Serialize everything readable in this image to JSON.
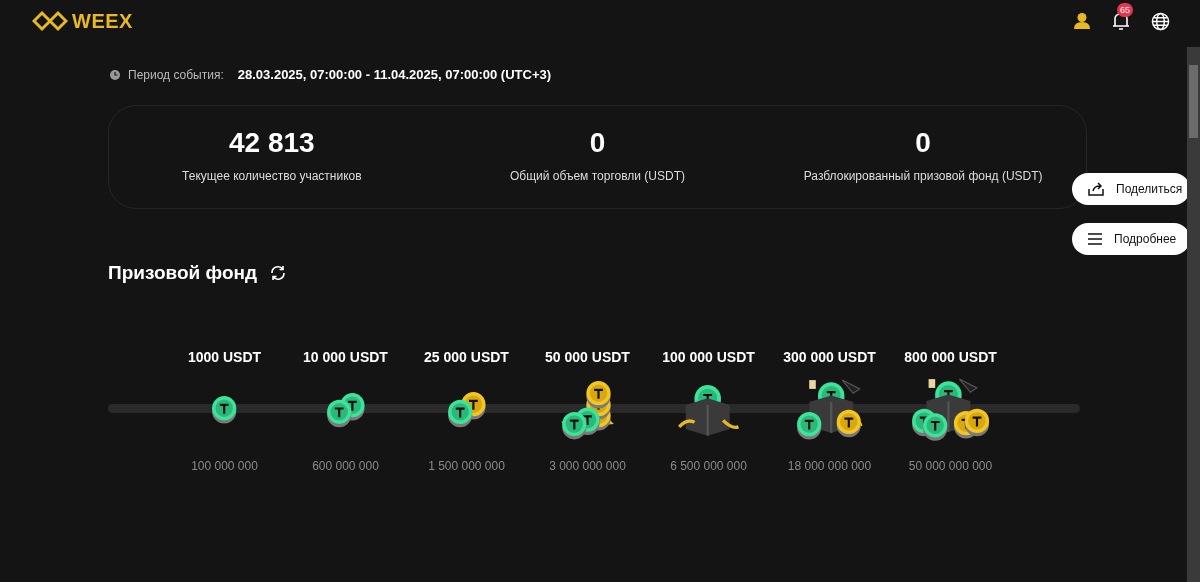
{
  "header": {
    "logo": "WEEX",
    "notifications": "65"
  },
  "event_period": {
    "label": "Период события:",
    "value": "28.03.2025, 07:00:00 - 11.04.2025, 07:00:00 (UTC+3)"
  },
  "stats": [
    {
      "value": "42 813",
      "label": "Текущее количество участников"
    },
    {
      "value": "0",
      "label": "Общий объем торговли (USDT)"
    },
    {
      "value": "0",
      "label": "Разблокированный призовой фонд (USDT)"
    }
  ],
  "side_buttons": [
    {
      "kind": "share",
      "label": "Поделиться"
    },
    {
      "kind": "more",
      "label": "Подробнее"
    }
  ],
  "prize_pool": {
    "title": "Призовой фонд",
    "tiers": [
      {
        "prize": "1000 USDT",
        "kind": "coin",
        "volume": "100 000 000"
      },
      {
        "prize": "10 000 USDT",
        "kind": "coins",
        "volume": "600 000 000"
      },
      {
        "prize": "25 000 USDT",
        "kind": "coin-gold",
        "volume": "1 500 000 000"
      },
      {
        "prize": "50 000 USDT",
        "kind": "stack",
        "volume": "3 000 000 000"
      },
      {
        "prize": "100 000 USDT",
        "kind": "box",
        "volume": "6 500 000 000"
      },
      {
        "prize": "300 000 USDT",
        "kind": "box-coins",
        "volume": "18 000 000 000"
      },
      {
        "prize": "800 000 USDT",
        "kind": "box-big",
        "volume": "50 000 000 000"
      }
    ]
  }
}
